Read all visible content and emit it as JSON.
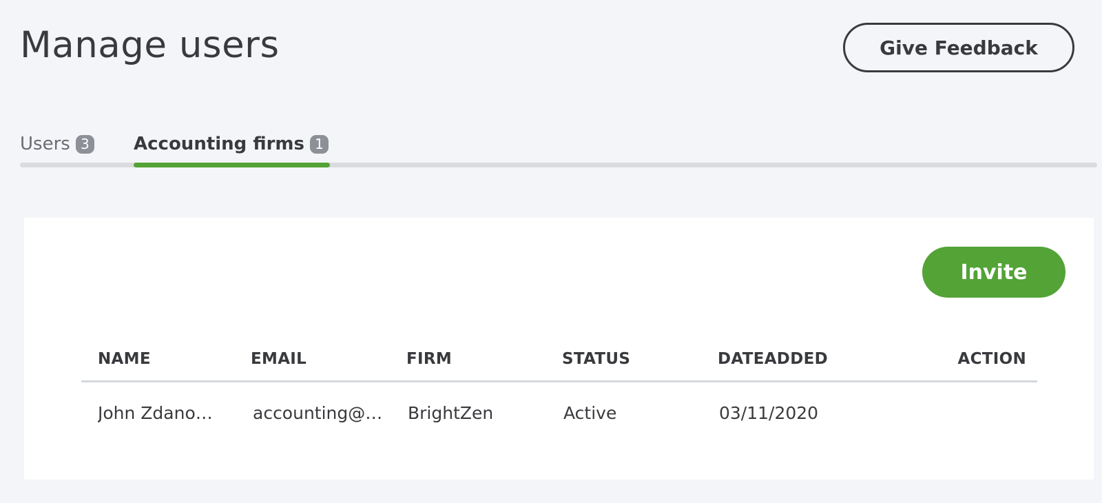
{
  "header": {
    "title": "Manage users",
    "feedback_label": "Give Feedback"
  },
  "tabs": [
    {
      "label": "Users",
      "count": "3",
      "active": false
    },
    {
      "label": "Accounting firms",
      "count": "1",
      "active": true
    }
  ],
  "actions": {
    "invite_label": "Invite"
  },
  "table": {
    "columns": [
      "NAME",
      "EMAIL",
      "FIRM",
      "STATUS",
      "DATEADDED",
      "ACTION"
    ],
    "rows": [
      {
        "name": "John Zdano…",
        "email": "accounting@…",
        "firm": "BrightZen",
        "status": "Active",
        "date_added": "03/11/2020",
        "action": ""
      }
    ]
  },
  "colors": {
    "accent": "#53a336",
    "text": "#393a3d",
    "background": "#f4f5f8",
    "badge": "#8d9096"
  }
}
